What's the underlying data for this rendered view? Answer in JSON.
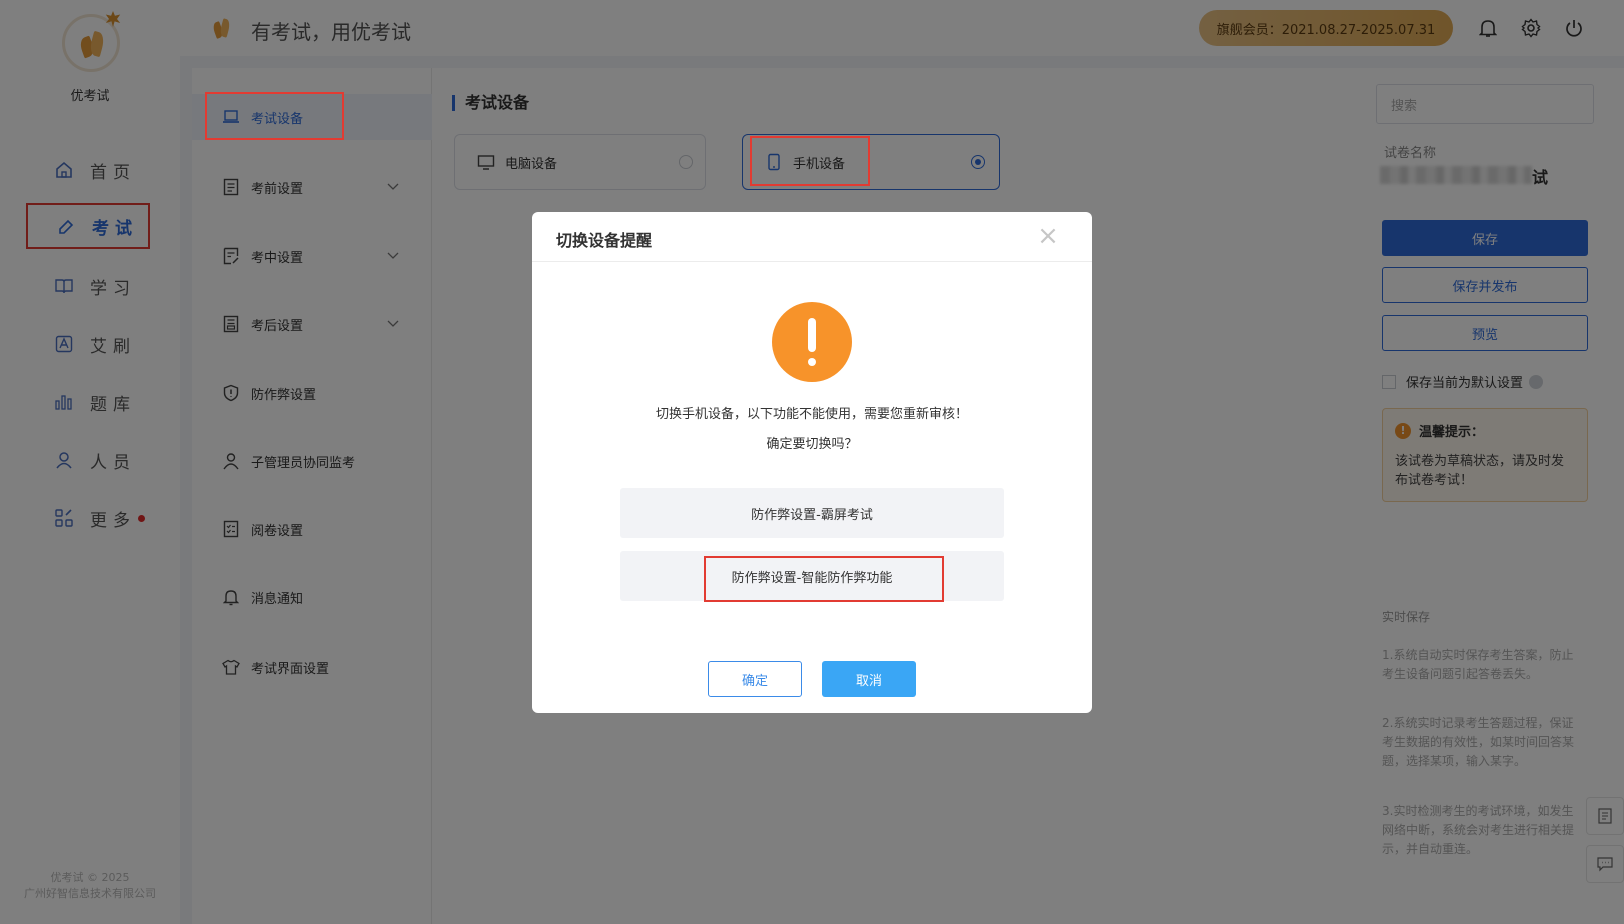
{
  "app": {
    "name": "优考试",
    "slogan": "有考试，用优考试",
    "copyright": [
      "优考试 © 2025",
      "广州好智信息技术有限公司"
    ]
  },
  "topbar": {
    "membership": "旗舰会员：2021.08.27-2025.07.31"
  },
  "rail": {
    "items": [
      {
        "label": "首页",
        "icon": "home-icon"
      },
      {
        "label": "考试",
        "icon": "eraser-icon",
        "active": true
      },
      {
        "label": "学习",
        "icon": "book-icon"
      },
      {
        "label": "艾刷",
        "icon": "letter-a-icon"
      },
      {
        "label": "题库",
        "icon": "bar-chart-icon"
      },
      {
        "label": "人员",
        "icon": "person-icon"
      },
      {
        "label": "更多",
        "icon": "grid-icon",
        "badge_dot": true
      }
    ]
  },
  "subnav": {
    "items": [
      {
        "label": "考试设备",
        "icon": "laptop-icon",
        "active": true
      },
      {
        "label": "考前设置",
        "icon": "clipboard-icon",
        "chevron": true
      },
      {
        "label": "考中设置",
        "icon": "edit-doc-icon",
        "chevron": true
      },
      {
        "label": "考后设置",
        "icon": "report-icon",
        "chevron": true
      },
      {
        "label": "防作弊设置",
        "icon": "shield-icon"
      },
      {
        "label": "子管理员协同监考",
        "icon": "users-icon"
      },
      {
        "label": "阅卷设置",
        "icon": "checklist-icon"
      },
      {
        "label": "消息通知",
        "icon": "bell-icon"
      },
      {
        "label": "考试界面设置",
        "icon": "shirt-icon"
      }
    ]
  },
  "main": {
    "section_title": "考试设备",
    "devices": [
      {
        "label": "电脑设备",
        "icon": "monitor-icon",
        "selected": false
      },
      {
        "label": "手机设备",
        "icon": "phone-icon",
        "selected": true
      }
    ]
  },
  "right": {
    "search_placeholder": "搜索",
    "paper_name_label": "试卷名称",
    "paper_name_visible": "试",
    "save": "保存",
    "save_publish": "保存并发布",
    "preview": "预览",
    "default_setting": "保存当前为默认设置",
    "tip_title": "温馨提示：",
    "tip_body": "该试卷为草稿状态，请及时发布试卷考试！",
    "autosave_title": "实时保存",
    "autosave_points": [
      "1.系统自动实时保存考生答案，防止考生设备问题引起答卷丢失。",
      "2.系统实时记录考生答题过程，保证考生数据的有效性，如某时间回答某题，选择某项，输入某字。",
      "3.实时检测考生的考试环境，如发生网络中断，系统会对考生进行相关提示，并自动重连。"
    ]
  },
  "modal": {
    "title": "切换设备提醒",
    "message_line1": "切换手机设备，以下功能不能使用，需要您重新审核！",
    "message_line2": "确定要切换吗？",
    "options": [
      "防作弊设置-霸屏考试",
      "防作弊设置-智能防作弊功能"
    ],
    "confirm": "确定",
    "cancel": "取消"
  },
  "colors": {
    "accent": "#2f6bd8",
    "warning": "#f7932a",
    "highlight_box": "#e23b32",
    "cancel_button": "#3aa6f5"
  }
}
